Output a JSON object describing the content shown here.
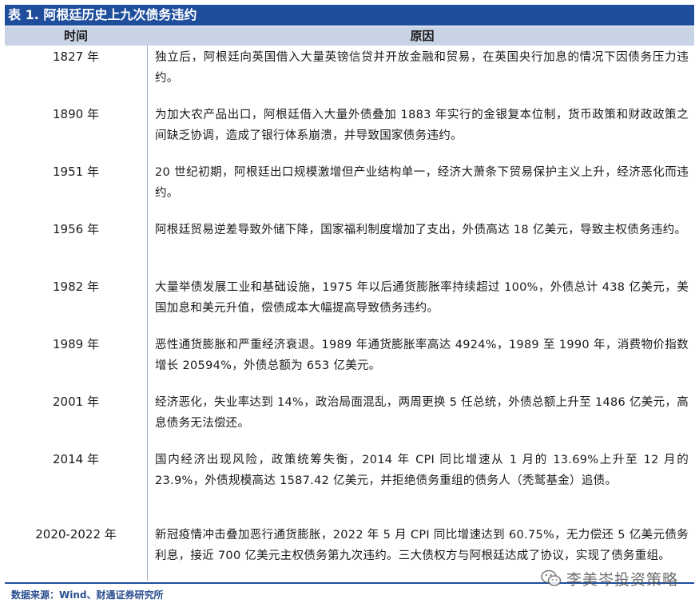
{
  "title": "表 1. 阿根廷历史上九次债务违约",
  "header": {
    "time": "时间",
    "reason": "原因"
  },
  "rows": [
    {
      "year": "1827 年",
      "reason": "独立后，阿根廷向英国借入大量英镑信贷并开放金融和贸易，在英国央行加息的情况下因债务压力违约。"
    },
    {
      "year": "1890 年",
      "reason": "为加大农产品出口，阿根廷借入大量外债叠加 1883 年实行的金银复本位制，货币政策和财政政策之间缺乏协调，造成了银行体系崩溃，并导致国家债务违约。"
    },
    {
      "year": "1951 年",
      "reason": "20 世纪初期，阿根廷出口规模激增但产业结构单一，经济大萧条下贸易保护主义上升，经济恶化而违约。"
    },
    {
      "year": "1956 年",
      "reason": "阿根廷贸易逆差导致外储下降，国家福利制度增加了支出，外债高达 18 亿美元，导致主权债务违约。"
    },
    {
      "year": "1982 年",
      "reason": "大量举债发展工业和基础设施，1975 年以后通货膨胀率持续超过 100%，外债总计 438 亿美元，美国加息和美元升值，偿债成本大幅提高导致债务违约。"
    },
    {
      "year": "1989 年",
      "reason": "恶性通货膨胀和严重经济衰退。1989 年通货膨胀率高达 4924%，1989 至 1990 年，消费物价指数增长 20594%，外债总额为 653 亿美元。"
    },
    {
      "year": "2001 年",
      "reason": "经济恶化，失业率达到 14%，政治局面混乱，两周更换 5 任总统，外债总额上升至 1486 亿美元，高息债务无法偿还。"
    },
    {
      "year": "2014 年",
      "reason": "国内经济出现风险，政策统筹失衡，2014 年 CPI 同比增速从 1 月的 13.69%上升至 12 月的 23.9%，外债规模高达 1587.42 亿美元，并拒绝债务重组的债务人（秃鹫基金）追债。"
    },
    {
      "year": "2020-2022 年",
      "reason": "新冠疫情冲击叠加恶行通货膨胀，2022 年 5 月 CPI 同比增速达到 60.75%，无力偿还 5 亿美元债务利息，接近 700 亿美元主权债务第九次违约。三大债权方与阿根廷达成了协议，实现了债务重组。"
    }
  ],
  "source": "数据来源：Wind、财通证券研究所",
  "watermark": "李美岑投资策略",
  "colors": {
    "title_bg": "#1f4e9c",
    "header_bg": "#c9d3e6",
    "source_text": "#2a4f8f"
  }
}
